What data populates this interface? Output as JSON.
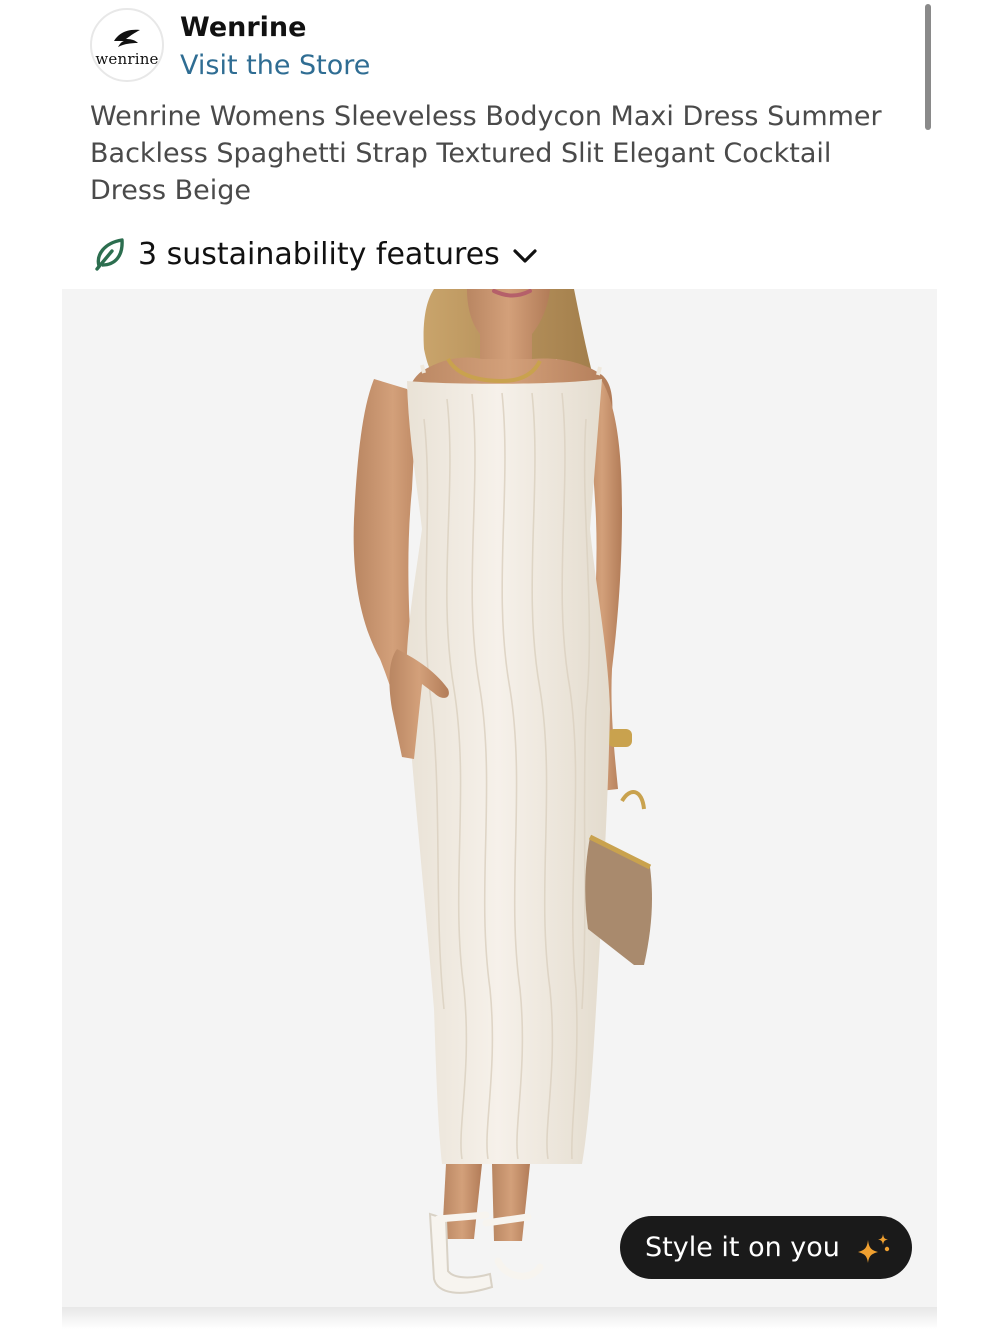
{
  "header": {
    "logo_text": "wenrine",
    "brand_name": "Wenrine",
    "store_link": "Visit the Store"
  },
  "product": {
    "title": "Wenrine Womens Sleeveless Bodycon Maxi Dress Summer Backless Spaghetti Strap Textured Slit Elegant Cocktail Dress Beige"
  },
  "sustainability": {
    "label": "3 sustainability features",
    "icon": "leaf-icon",
    "expand_icon": "chevron-down-icon"
  },
  "image": {
    "style_button_label": "Style it on you",
    "style_button_icon": "sparkle-icon"
  },
  "colors": {
    "link": "#2f6d93",
    "leaf": "#2c6e4f",
    "button_bg": "#1a1a1a",
    "sparkle": "#f0a030"
  }
}
